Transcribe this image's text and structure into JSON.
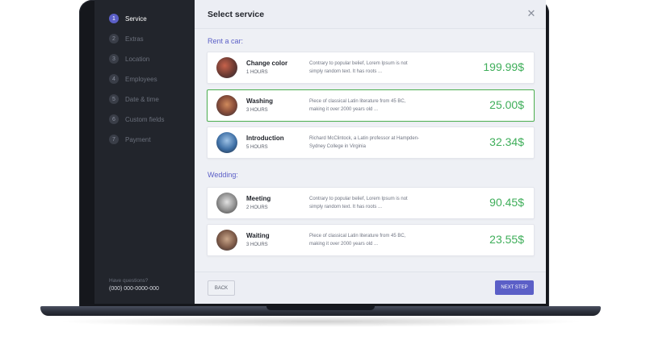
{
  "sidebar": {
    "steps": [
      {
        "number": "1",
        "label": "Service",
        "active": true
      },
      {
        "number": "2",
        "label": "Extras"
      },
      {
        "number": "3",
        "label": "Location"
      },
      {
        "number": "4",
        "label": "Employees"
      },
      {
        "number": "5",
        "label": "Date & time"
      },
      {
        "number": "6",
        "label": "Custom fields"
      },
      {
        "number": "7",
        "label": "Payment"
      }
    ],
    "help_question": "Have questions?",
    "help_phone": "(000) 000-0000-000"
  },
  "header": {
    "title": "Select service",
    "close_icon": "close-icon"
  },
  "sections": [
    {
      "title": "Rent a car:",
      "services": [
        {
          "name": "Change color",
          "duration": "1 HOURS",
          "description": "Contrary to popular belief, Lorem Ipsum is not simply random text. It has roots ...",
          "price": "199.99$"
        },
        {
          "name": "Washing",
          "duration": "3 HOURS",
          "description": "Piece of classical Latin literature from 45 BC, making it over 2000 years old ...",
          "price": "25.00$",
          "selected": true
        },
        {
          "name": "Introduction",
          "duration": "5 HOURS",
          "description": "Richard McClintock, a Latin professor at Hampden-Sydney College in Virginia",
          "price": "32.34$"
        }
      ]
    },
    {
      "title": "Wedding:",
      "services": [
        {
          "name": "Meeting",
          "duration": "2 HOURS",
          "description": "Contrary to popular belief, Lorem Ipsum is not simply random text. It has roots ...",
          "price": "90.45$"
        },
        {
          "name": "Waiting",
          "duration": "3 HOURS",
          "description": "Piece of classical Latin literature from 45 BC, making it over 2000 years old ...",
          "price": "23.55$"
        }
      ]
    }
  ],
  "footer": {
    "back_label": "BACK",
    "next_label": "NEXT STEP"
  },
  "colors": {
    "accent": "#5b5fc7",
    "price": "#3fae5a",
    "selected_border": "#4caf50",
    "sidebar_bg": "#22252c"
  }
}
